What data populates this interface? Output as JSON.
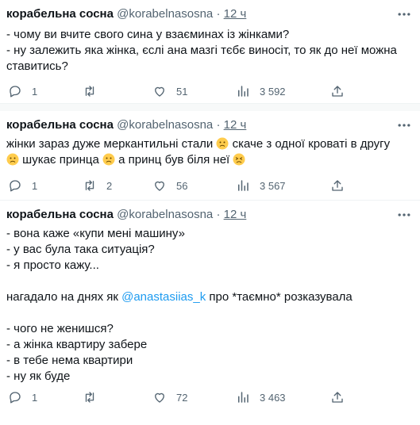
{
  "tweets": [
    {
      "name": "корабельна сосна",
      "handle": "@korabelnasosna",
      "dot": "·",
      "time": "12 ч",
      "text": "- чому ви вчите свого сина у взаєминах із жінками?\n- ну залежить яка жінка, єслі ана мазгі тєбє виносіт, то як до неї можна ставитись?",
      "replies": "1",
      "retweets": "",
      "likes": "51",
      "views": "3 592"
    },
    {
      "name": "корабельна сосна",
      "handle": "@korabelnasosna",
      "dot": "·",
      "time": "12 ч",
      "text_a": "жінки зараз дуже меркантильні стали ",
      "text_b": " скаче з одної кроваті в другу",
      "text_c": " шукає принца ",
      "text_d": " а принц був біля неї ",
      "replies": "1",
      "retweets": "2",
      "likes": "56",
      "views": "3 567"
    },
    {
      "name": "корабельна сосна",
      "handle": "@korabelnasosna",
      "dot": "·",
      "time": "12 ч",
      "text_a": "- вона каже «купи мені машину»\n- у вас була така ситуація?\n- я просто кажу...\n\nнагадало на днях як ",
      "mention": "@anastasiias_k",
      "text_b": " про *таємно* розказувала\n\n- чого не женишся?\n- а жінка квартиру забере\n- в тебе нема квартири\n- ну як буде",
      "replies": "1",
      "retweets": "",
      "likes": "72",
      "views": "3 463"
    }
  ],
  "colors": {
    "text": "#0f1419",
    "muted": "#536471",
    "link": "#1d9bf0",
    "divider": "#eff3f4"
  },
  "icons": [
    "more-icon",
    "reply-icon",
    "retweet-icon",
    "like-icon",
    "views-icon",
    "share-icon",
    "slightly-frowning-face-emoji",
    "persevering-face-emoji"
  ]
}
